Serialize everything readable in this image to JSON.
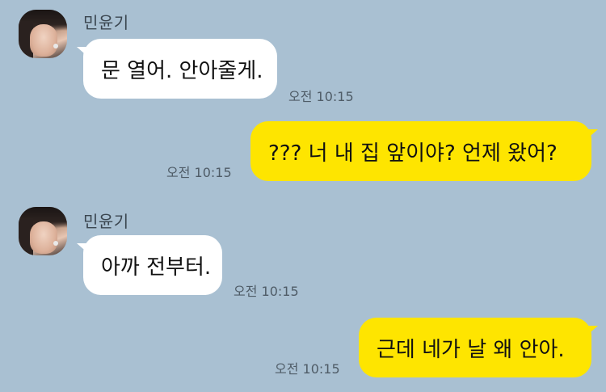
{
  "chat": {
    "messages": [
      {
        "sender_name": "민윤기",
        "text": "문 열어. 안아줄게.",
        "time": "오전 10:15",
        "direction": "incoming"
      },
      {
        "text": "??? 너 내 집 앞이야? 언제 왔어?",
        "time": "오전 10:15",
        "direction": "outgoing"
      },
      {
        "sender_name": "민윤기",
        "text": "아까 전부터.",
        "time": "오전 10:15",
        "direction": "incoming"
      },
      {
        "text": "근데 네가 날 왜 안아.",
        "time": "오전 10:15",
        "direction": "outgoing"
      }
    ]
  },
  "colors": {
    "background": "#a9c0d2",
    "incoming_bubble": "#ffffff",
    "outgoing_bubble": "#fee500"
  }
}
